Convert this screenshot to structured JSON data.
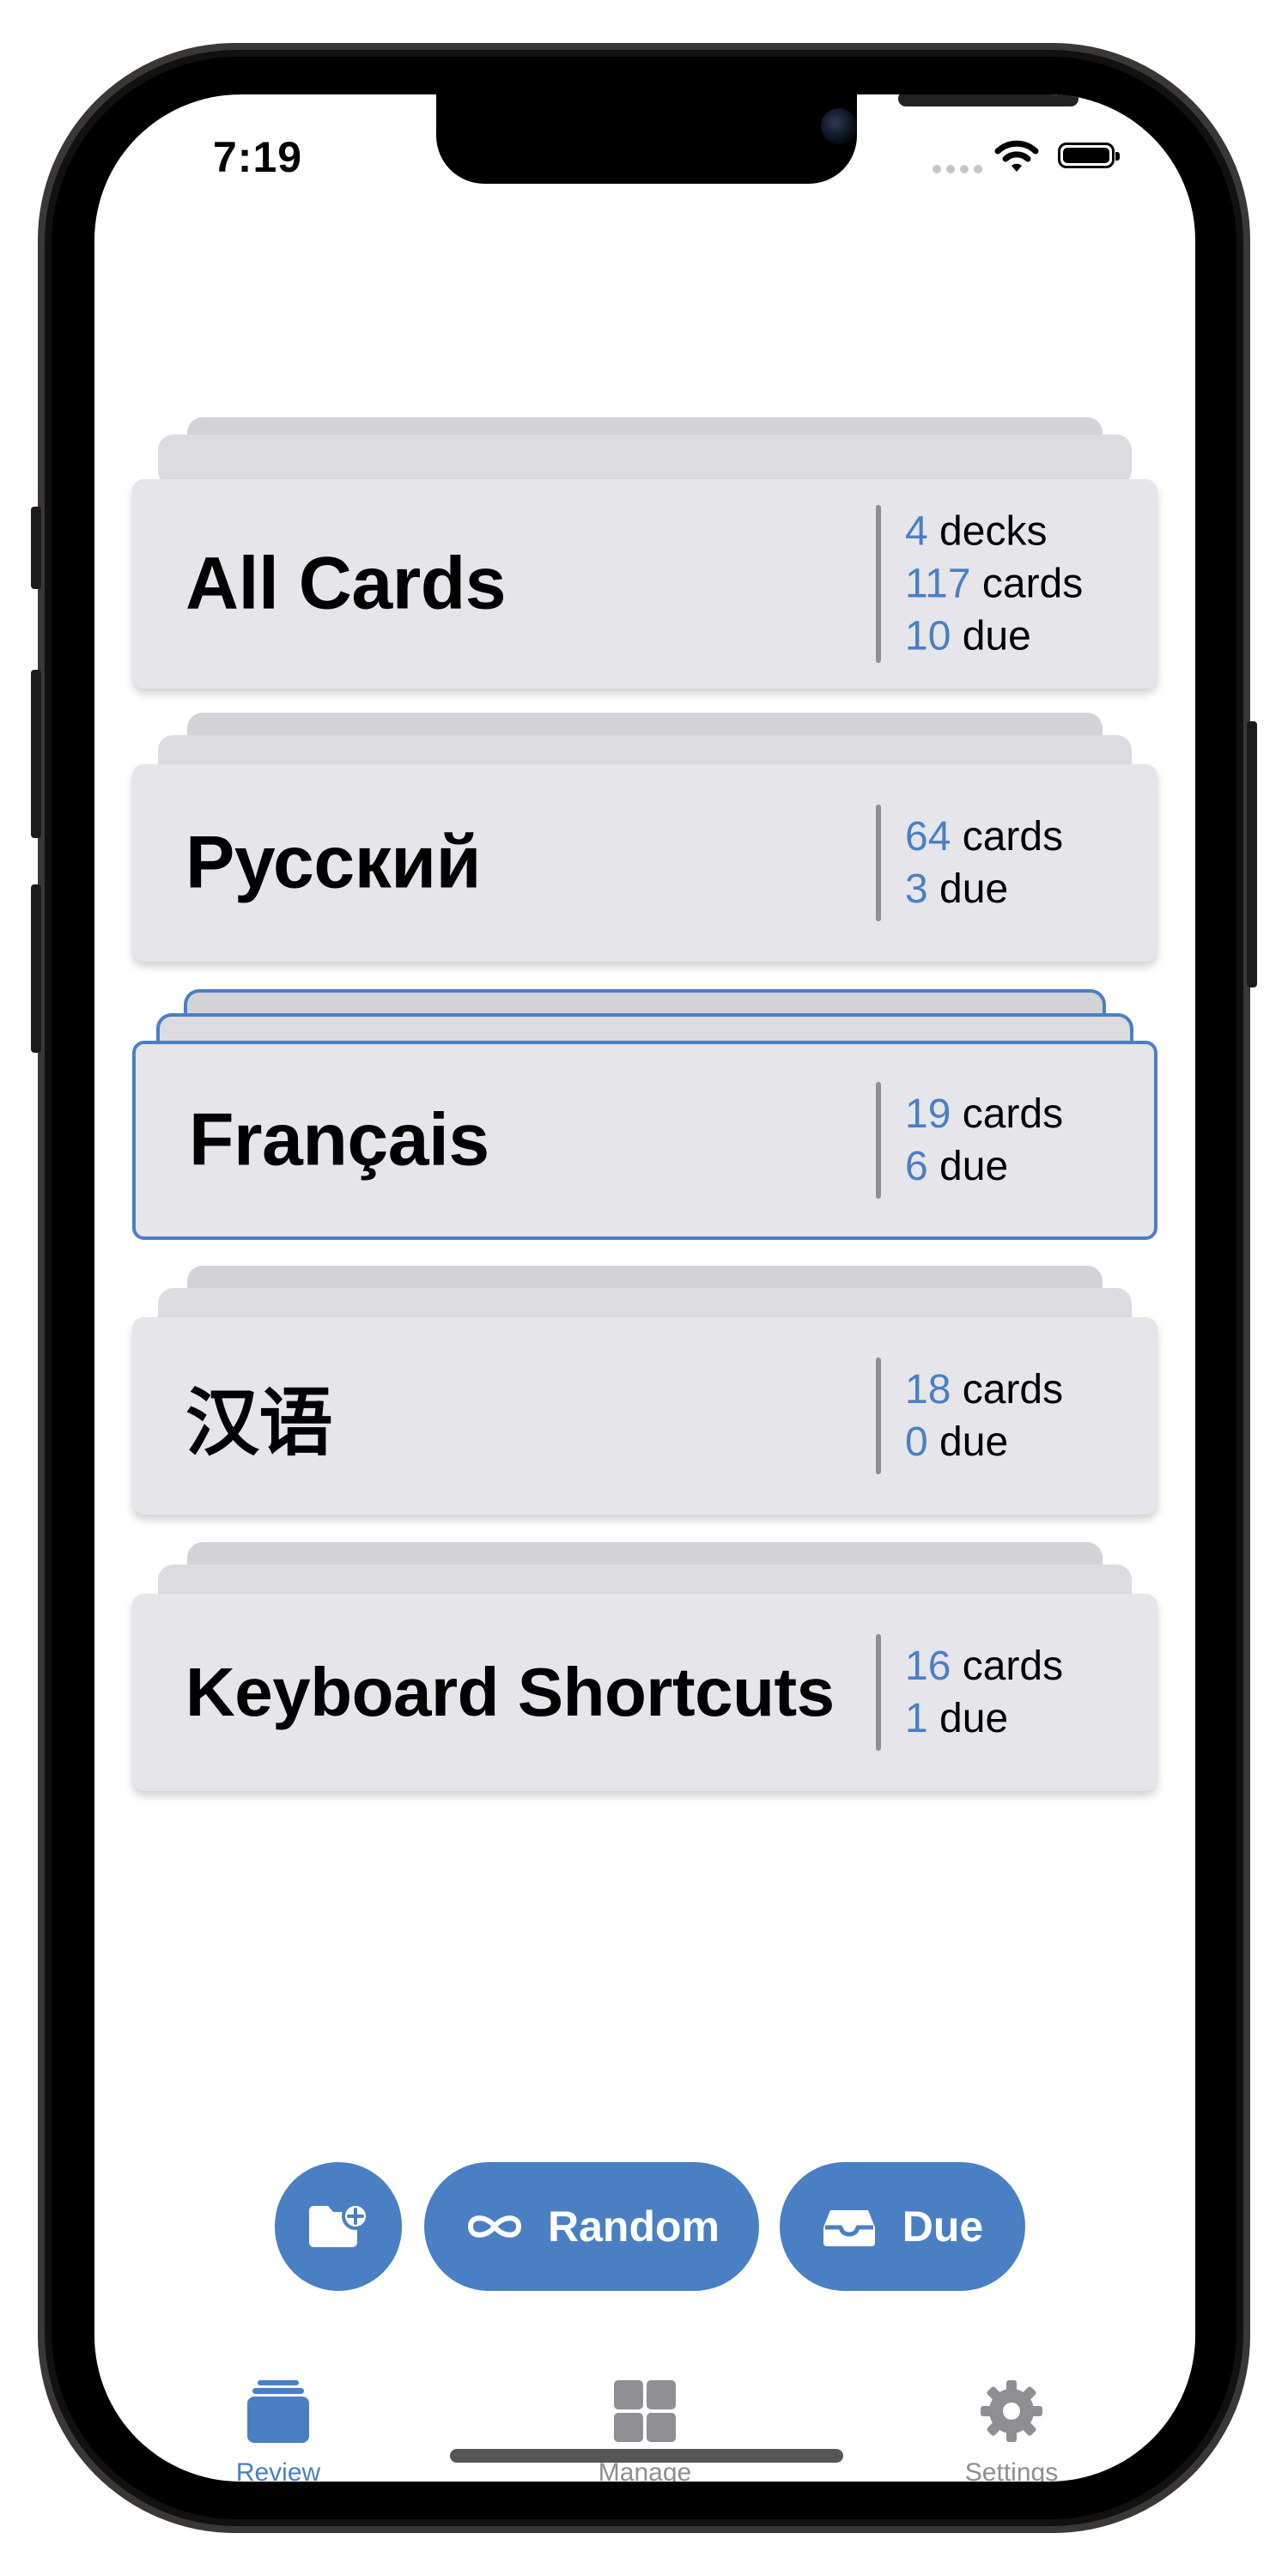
{
  "status_bar": {
    "time": "7:19"
  },
  "decks": [
    {
      "title": "All Cards",
      "stats": [
        {
          "num": "4",
          "unit": "decks"
        },
        {
          "num": "117",
          "unit": "cards"
        },
        {
          "num": "10",
          "unit": "due"
        }
      ],
      "selected": false
    },
    {
      "title": "Русский",
      "stats": [
        {
          "num": "64",
          "unit": "cards"
        },
        {
          "num": "3",
          "unit": "due"
        }
      ],
      "selected": false
    },
    {
      "title": "Français",
      "stats": [
        {
          "num": "19",
          "unit": "cards"
        },
        {
          "num": "6",
          "unit": "due"
        }
      ],
      "selected": true
    },
    {
      "title": "汉语",
      "stats": [
        {
          "num": "18",
          "unit": "cards"
        },
        {
          "num": "0",
          "unit": "due"
        }
      ],
      "selected": false
    },
    {
      "title": "Keyboard Shortcuts",
      "stats": [
        {
          "num": "16",
          "unit": "cards"
        },
        {
          "num": "1",
          "unit": "due"
        }
      ],
      "selected": false
    }
  ],
  "actions": {
    "new_deck_icon": "folder-plus-icon",
    "random_label": "Random",
    "random_icon": "infinity-icon",
    "due_label": "Due",
    "due_icon": "tray-icon"
  },
  "tabs": [
    {
      "label": "Review",
      "icon": "cards-stack-icon",
      "active": true
    },
    {
      "label": "Manage",
      "icon": "grid-icon",
      "active": false
    },
    {
      "label": "Settings",
      "icon": "gear-icon",
      "active": false
    }
  ],
  "colors": {
    "accent": "#4a7fc4",
    "inactive": "#8e8e93",
    "card": "#e5e5ea"
  }
}
